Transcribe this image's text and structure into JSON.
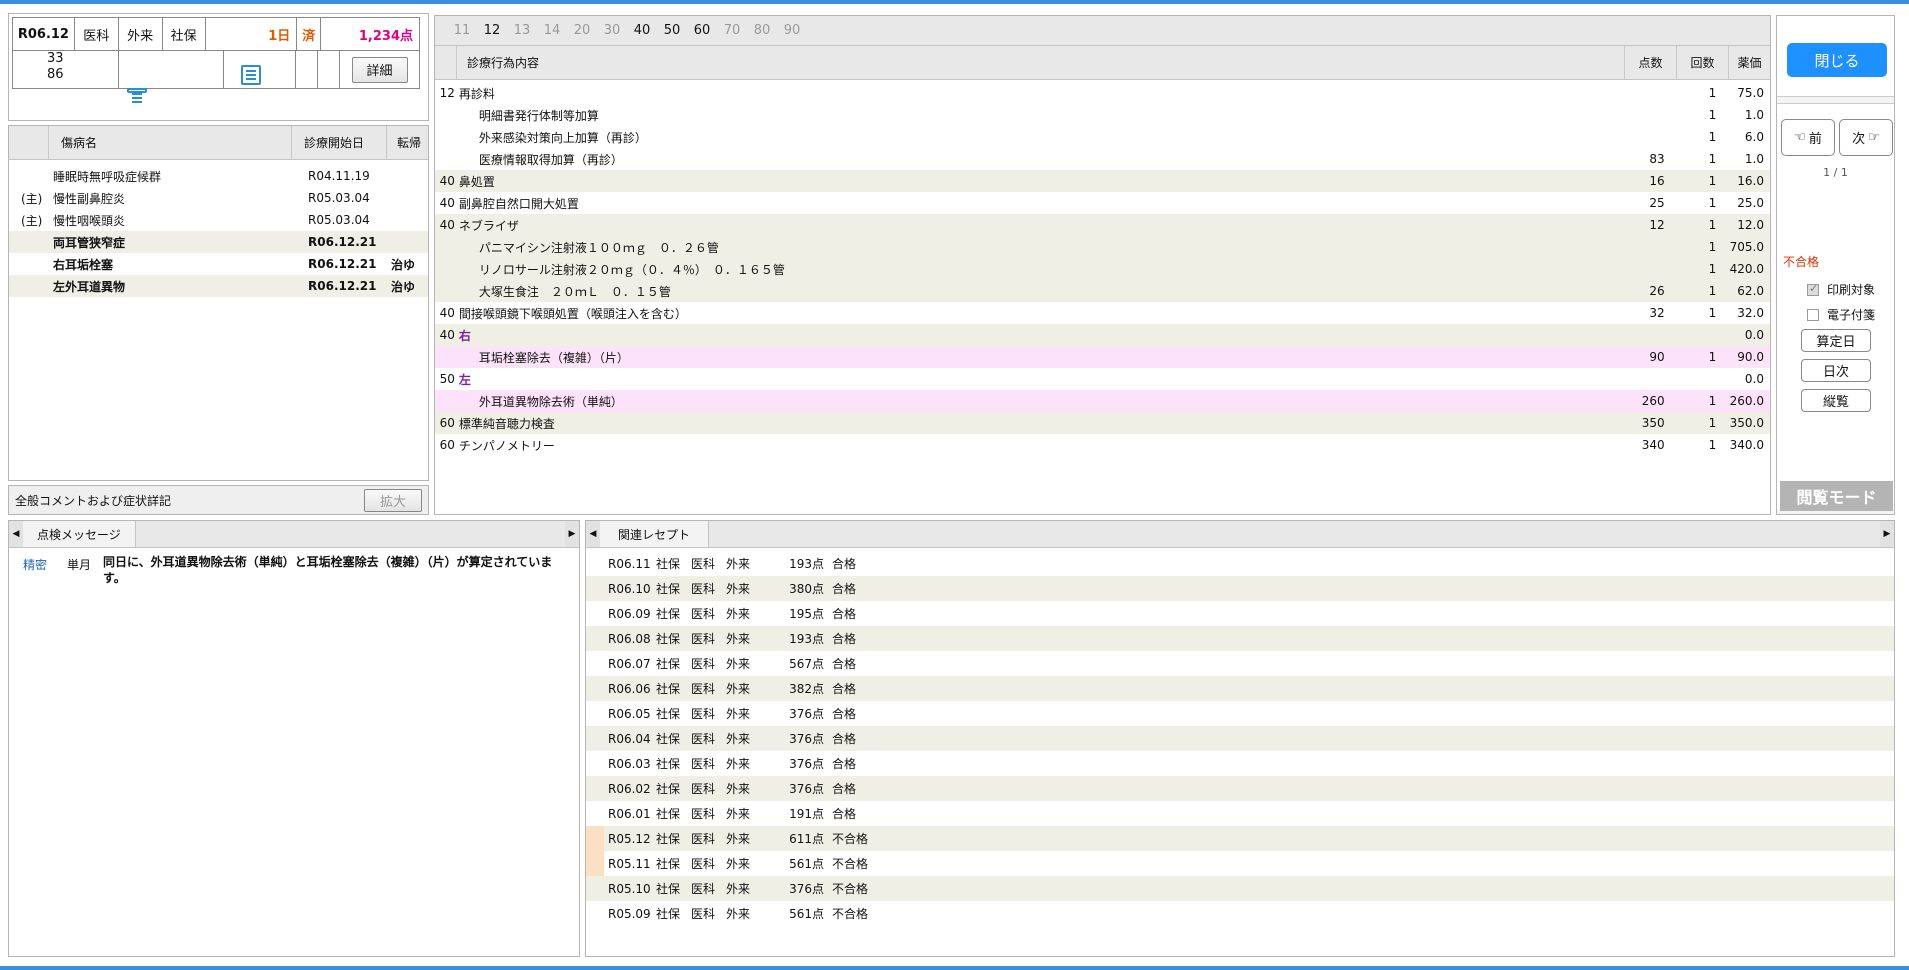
{
  "header": {
    "month": "R06.12",
    "dept": "医科",
    "visit_type": "外来",
    "insurance": "社保",
    "days": "1日",
    "done": "済",
    "points": "1,234点",
    "num_top": "33",
    "num_bottom": "86",
    "detail_button": "詳細"
  },
  "colors": {
    "accent": "#1e90ff",
    "orange": "#e05a00",
    "pink": "#e0008a",
    "purple": "#7a1fa6",
    "error": "#e03000"
  },
  "diseases": {
    "headers": [
      "傷病名",
      "診療開始日",
      "転帰"
    ],
    "rows": [
      {
        "tag": "",
        "name": "睡眠時無呼吸症候群",
        "date": "R04.11.19",
        "outcome": "",
        "bold": false
      },
      {
        "tag": "(主)",
        "name": "慢性副鼻腔炎",
        "date": "R05.03.04",
        "outcome": "",
        "bold": false
      },
      {
        "tag": "(主)",
        "name": "慢性咽喉頭炎",
        "date": "R05.03.04",
        "outcome": "",
        "bold": false
      },
      {
        "tag": "",
        "name": "両耳管狭窄症",
        "date": "R06.12.21",
        "outcome": "",
        "bold": true
      },
      {
        "tag": "",
        "name": "右耳垢栓塞",
        "date": "R06.12.21",
        "outcome": "治ゆ",
        "bold": true
      },
      {
        "tag": "",
        "name": "左外耳道異物",
        "date": "R06.12.21",
        "outcome": "治ゆ",
        "bold": true
      }
    ]
  },
  "comment": {
    "label": "全般コメントおよび症状詳記",
    "expand_button": "拡大"
  },
  "tabs": [
    "11",
    "12",
    "13",
    "14",
    "20",
    "30",
    "40",
    "50",
    "60",
    "70",
    "80",
    "90"
  ],
  "active_tabs": [
    "12",
    "40",
    "50",
    "60"
  ],
  "treatments": {
    "headers": [
      "診療行為内容",
      "点数",
      "回数",
      "薬価"
    ],
    "rows": [
      {
        "code": "12",
        "name": "再診料",
        "pts": "",
        "cnt": "1",
        "price": "75.0",
        "style": ""
      },
      {
        "code": "",
        "name": "明細書発行体制等加算",
        "pts": "",
        "cnt": "1",
        "price": "1.0",
        "style": ""
      },
      {
        "code": "",
        "name": "外来感染対策向上加算（再診）",
        "pts": "",
        "cnt": "1",
        "price": "6.0",
        "style": ""
      },
      {
        "code": "",
        "name": "医療情報取得加算（再診）",
        "pts": "83",
        "cnt": "1",
        "price": "1.0",
        "style": ""
      },
      {
        "code": "40",
        "name": "鼻処置",
        "pts": "16",
        "cnt": "1",
        "price": "16.0",
        "style": "alt"
      },
      {
        "code": "40",
        "name": "副鼻腔自然口開大処置",
        "pts": "25",
        "cnt": "1",
        "price": "25.0",
        "style": ""
      },
      {
        "code": "40",
        "name": "ネブライザ",
        "pts": "12",
        "cnt": "1",
        "price": "12.0",
        "style": "alt"
      },
      {
        "code": "",
        "name": "パニマイシン注射液１００ｍｇ　０．２６管",
        "pts": "",
        "cnt": "1",
        "price": "705.0",
        "style": "alt"
      },
      {
        "code": "",
        "name": "リノロサール注射液２０ｍｇ（０．４％）　０．１６５管",
        "pts": "",
        "cnt": "1",
        "price": "420.0",
        "style": "alt"
      },
      {
        "code": "",
        "name": "大塚生食注　２０ｍＬ　０．１５管",
        "pts": "26",
        "cnt": "1",
        "price": "62.0",
        "style": "alt"
      },
      {
        "code": "40",
        "name": "間接喉頭鏡下喉頭処置（喉頭注入を含む）",
        "pts": "32",
        "cnt": "1",
        "price": "32.0",
        "style": ""
      },
      {
        "code": "40",
        "name": "右",
        "pts": "",
        "cnt": "",
        "price": "0.0",
        "style": "alt purple"
      },
      {
        "code": "",
        "name": "耳垢栓塞除去（複雑）（片）",
        "pts": "90",
        "cnt": "1",
        "price": "90.0",
        "style": "pink"
      },
      {
        "code": "50",
        "name": "左",
        "pts": "",
        "cnt": "",
        "price": "0.0",
        "style": "purple"
      },
      {
        "code": "",
        "name": "外耳道異物除去術（単純）",
        "pts": "260",
        "cnt": "1",
        "price": "260.0",
        "style": "pink"
      },
      {
        "code": "60",
        "name": "標準純音聴力検査",
        "pts": "350",
        "cnt": "1",
        "price": "350.0",
        "style": "alt"
      },
      {
        "code": "60",
        "name": "チンパノメトリー",
        "pts": "340",
        "cnt": "1",
        "price": "340.0",
        "style": ""
      }
    ]
  },
  "sidebar": {
    "close_button": "閉じる",
    "prev_button": "前",
    "next_button": "次",
    "page": "1 / 1",
    "status": "不合格",
    "print_target": "印刷対象",
    "e_attach": "電子付箋",
    "calc_date_button": "算定日",
    "daily_button": "日次",
    "vertical_button": "縦覧",
    "mode": "閲覧モード"
  },
  "messages": {
    "tab": "点検メッセージ",
    "rows": [
      {
        "level": "精密",
        "period": "単月",
        "text": "同日に、外耳道異物除去術（単純）と耳垢栓塞除去（複雑）（片）が算定されています。"
      }
    ]
  },
  "related": {
    "tab": "関連レセプト",
    "rows": [
      {
        "month": "R06.11",
        "ins": "社保",
        "dept": "医科",
        "type": "外来",
        "pts": "193点",
        "result": "合格",
        "flag": false
      },
      {
        "month": "R06.10",
        "ins": "社保",
        "dept": "医科",
        "type": "外来",
        "pts": "380点",
        "result": "合格",
        "flag": false
      },
      {
        "month": "R06.09",
        "ins": "社保",
        "dept": "医科",
        "type": "外来",
        "pts": "195点",
        "result": "合格",
        "flag": false
      },
      {
        "month": "R06.08",
        "ins": "社保",
        "dept": "医科",
        "type": "外来",
        "pts": "193点",
        "result": "合格",
        "flag": false
      },
      {
        "month": "R06.07",
        "ins": "社保",
        "dept": "医科",
        "type": "外来",
        "pts": "567点",
        "result": "合格",
        "flag": false
      },
      {
        "month": "R06.06",
        "ins": "社保",
        "dept": "医科",
        "type": "外来",
        "pts": "382点",
        "result": "合格",
        "flag": false
      },
      {
        "month": "R06.05",
        "ins": "社保",
        "dept": "医科",
        "type": "外来",
        "pts": "376点",
        "result": "合格",
        "flag": false
      },
      {
        "month": "R06.04",
        "ins": "社保",
        "dept": "医科",
        "type": "外来",
        "pts": "376点",
        "result": "合格",
        "flag": false
      },
      {
        "month": "R06.03",
        "ins": "社保",
        "dept": "医科",
        "type": "外来",
        "pts": "376点",
        "result": "合格",
        "flag": false
      },
      {
        "month": "R06.02",
        "ins": "社保",
        "dept": "医科",
        "type": "外来",
        "pts": "376点",
        "result": "合格",
        "flag": false
      },
      {
        "month": "R06.01",
        "ins": "社保",
        "dept": "医科",
        "type": "外来",
        "pts": "191点",
        "result": "合格",
        "flag": false
      },
      {
        "month": "R05.12",
        "ins": "社保",
        "dept": "医科",
        "type": "外来",
        "pts": "611点",
        "result": "不合格",
        "flag": true
      },
      {
        "month": "R05.11",
        "ins": "社保",
        "dept": "医科",
        "type": "外来",
        "pts": "561点",
        "result": "不合格",
        "flag": true
      },
      {
        "month": "R05.10",
        "ins": "社保",
        "dept": "医科",
        "type": "外来",
        "pts": "376点",
        "result": "不合格",
        "flag": false
      },
      {
        "month": "R05.09",
        "ins": "社保",
        "dept": "医科",
        "type": "外来",
        "pts": "561点",
        "result": "不合格",
        "flag": false
      }
    ]
  }
}
